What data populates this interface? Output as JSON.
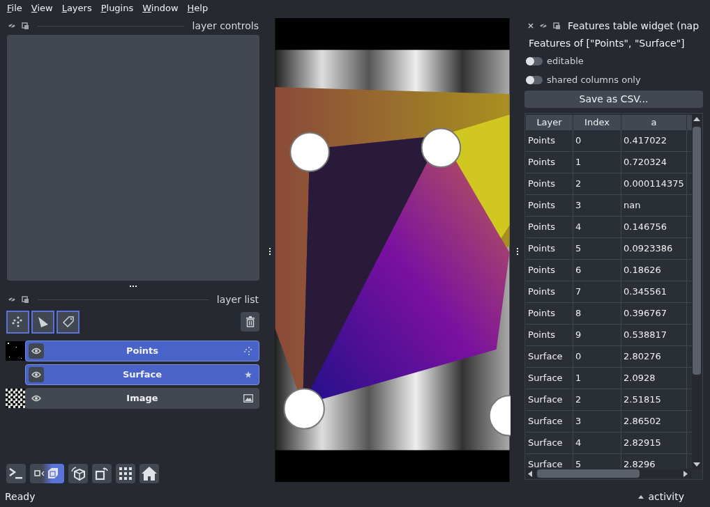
{
  "menu": [
    "File",
    "View",
    "Layers",
    "Plugins",
    "Window",
    "Help"
  ],
  "layer_controls": {
    "title": "layer controls"
  },
  "layer_list": {
    "title": "layer list",
    "layers": [
      {
        "name": "Points",
        "kind": "points",
        "selected": true,
        "visible": true
      },
      {
        "name": "Surface",
        "kind": "surface",
        "selected": true,
        "visible": true
      },
      {
        "name": "Image",
        "kind": "image",
        "selected": false,
        "visible": true
      }
    ]
  },
  "widget": {
    "title": "Features table widget (nap",
    "heading": "Features of [\"Points\", \"Surface\"]",
    "toggles": [
      {
        "label": "editable",
        "on": false
      },
      {
        "label": "shared columns only",
        "on": false
      }
    ],
    "save_button": "Save as CSV...",
    "table": {
      "columns": [
        "Layer",
        "Index",
        "a"
      ],
      "rows": [
        [
          "Points",
          "0",
          "0.417022"
        ],
        [
          "Points",
          "1",
          "0.720324"
        ],
        [
          "Points",
          "2",
          "0.000114375"
        ],
        [
          "Points",
          "3",
          "nan"
        ],
        [
          "Points",
          "4",
          "0.146756"
        ],
        [
          "Points",
          "5",
          "0.0923386"
        ],
        [
          "Points",
          "6",
          "0.18626"
        ],
        [
          "Points",
          "7",
          "0.345561"
        ],
        [
          "Points",
          "8",
          "0.396767"
        ],
        [
          "Points",
          "9",
          "0.538817"
        ],
        [
          "Surface",
          "0",
          "2.80276"
        ],
        [
          "Surface",
          "1",
          "2.0928"
        ],
        [
          "Surface",
          "2",
          "2.51815"
        ],
        [
          "Surface",
          "3",
          "2.86502"
        ],
        [
          "Surface",
          "4",
          "2.82915"
        ],
        [
          "Surface",
          "5",
          "2.8296"
        ]
      ]
    }
  },
  "status_bar": {
    "text": "Ready",
    "activity": "activity"
  }
}
